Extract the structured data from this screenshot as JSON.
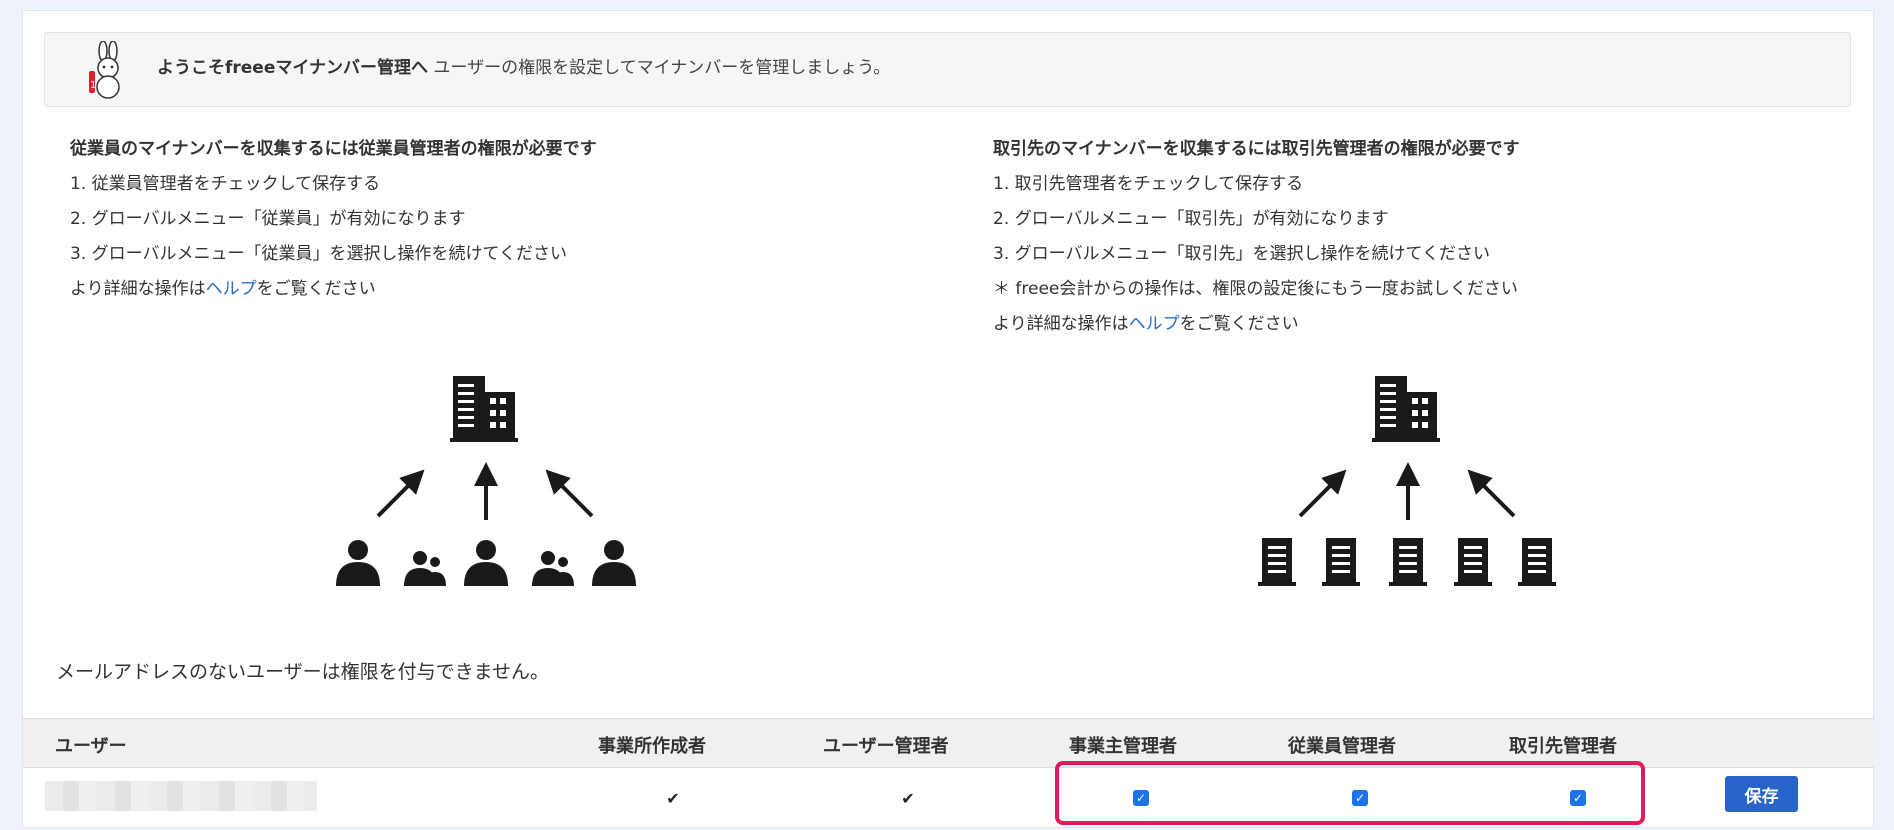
{
  "welcome": {
    "title": "ようこそfreeeマイナンバー管理へ",
    "subtitle": " ユーザーの権限を設定してマイナンバーを管理しましょう。",
    "mascot_icon": "mascot-rabbit-icon"
  },
  "employee_section": {
    "heading": "従業員のマイナンバーを収集するには従業員管理者の権限が必要です",
    "steps": [
      "1. 従業員管理者をチェックして保存する",
      "2. グローバルメニュー「従業員」が有効になります",
      "3. グローバルメニュー「従業員」を選択し操作を続けてください"
    ],
    "help_prefix": "より詳細な操作は",
    "help_link": "ヘルプ",
    "help_suffix": "をご覧ください"
  },
  "partner_section": {
    "heading": "取引先のマイナンバーを収集するには取引先管理者の権限が必要です",
    "steps": [
      "1. 取引先管理者をチェックして保存する",
      "2. グローバルメニュー「取引先」が有効になります",
      "3. グローバルメニュー「取引先」を選択し操作を続けてください"
    ],
    "note": "＊ freee会計からの操作は、権限の設定後にもう一度お試しください",
    "help_prefix": "より詳細な操作は",
    "help_link": "ヘルプ",
    "help_suffix": "をご覧ください"
  },
  "no_email_note": "メールアドレスのないユーザーは権限を付与できません。",
  "table": {
    "headers": {
      "user": "ユーザー",
      "office_creator": "事業所作成者",
      "user_admin": "ユーザー管理者",
      "owner_admin": "事業主管理者",
      "employee_admin": "従業員管理者",
      "partner_admin": "取引先管理者"
    },
    "row": {
      "office_creator": "✔",
      "user_admin": "✔",
      "owner_admin_checked": true,
      "employee_admin_checked": true,
      "partner_admin_checked": true
    },
    "save_label": "保存"
  },
  "colors": {
    "link": "#2a6ec8",
    "save_button": "#2864c8",
    "highlight_border": "#e5195f",
    "checkbox": "#1a73e8"
  }
}
